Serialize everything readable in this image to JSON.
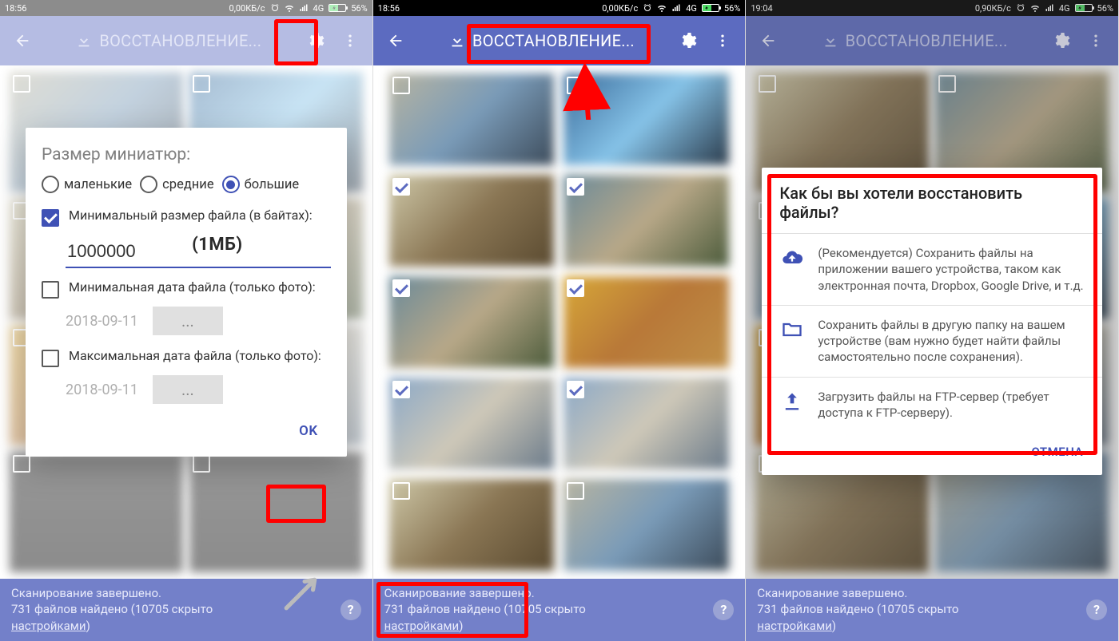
{
  "statusbar": {
    "time1": "18:56",
    "time2": "18:56",
    "time3": "19:04",
    "net1": "0,00КБ/с",
    "net3": "0,90КБ/с",
    "carrier": "4G",
    "battery_pct": "56%"
  },
  "appbar": {
    "title": "ВОССТАНОВЛЕНИЕ..."
  },
  "settings_dialog": {
    "title": "Размер миниатюр:",
    "radio_small": "маленькие",
    "radio_medium": "средние",
    "radio_large": "большие",
    "min_size_label": "Минимальный размер файла (в байтах):",
    "min_size_value": "1000000",
    "min_size_annot": "(1МБ)",
    "min_date_label": "Минимальная дата файла (только фото):",
    "min_date_value": "2018-09-11",
    "date_btn": "...",
    "max_date_label": "Максимальная дата файла (только фото):",
    "max_date_value": "2018-09-11",
    "ok": "OK"
  },
  "restore_dialog": {
    "title": "Как бы вы хотели восстановить файлы?",
    "opt1": "(Рекомендуется) Сохранить файлы на приложении вашего устройства, таком как электронная почта, Dropbox, Google Drive, и т.д.",
    "opt2": "Сохранить файлы в другую папку на вашем устройстве (вам нужно будет найти файлы самостоятельно после сохранения).",
    "opt3": "Загрузить файлы на FTP-сервер (требует доступа к FTP-серверу).",
    "cancel": "ОТМЕНА"
  },
  "footer": {
    "line1": "Сканирование завершено.",
    "line2a": "731 файлов найдено",
    "line2b": " (10705 скрыто ",
    "link": "настройками",
    "line2c": ")"
  }
}
